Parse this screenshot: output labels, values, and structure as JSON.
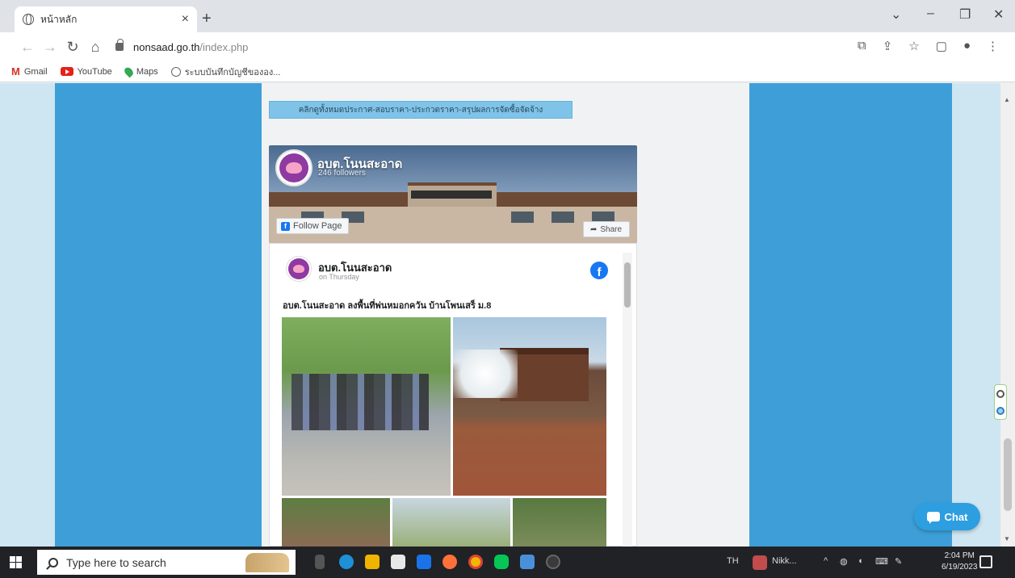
{
  "browser": {
    "tab_title": "หน้าหลัก",
    "url_host": "nonsaad.go.th",
    "url_path": "/index.php",
    "bookmarks": [
      "Gmail",
      "YouTube",
      "Maps",
      "ระบบบันทึกบัญชีขององ..."
    ]
  },
  "page": {
    "notice_text": "คลิกดูทั้งหมดประกาศ-สอบราคา-ประกวดราคา-สรุปผลการจัดซื้อจัดจ้าง",
    "fb_page_name": "อบต.โนนสะอาด",
    "fb_followers": "246 followers",
    "follow_label": "Follow Page",
    "share_label": "Share",
    "post_author": "อบต.โนนสะอาด",
    "post_date": "on Thursday",
    "post_text": "อบต.โนนสะอาด ลงพื้นที่พ่นหมอกควัน บ้านโพนเสร็ ม.8",
    "chat_label": "Chat"
  },
  "taskbar": {
    "search_placeholder": "Type here to search",
    "lang": "TH",
    "app_label": "Nikk...",
    "time": "2:04 PM",
    "date": "6/19/2023"
  },
  "colors": {
    "side_blue": "#3e9fd8",
    "facebook_blue": "#1877f2",
    "chat_blue": "#2d9ee0"
  }
}
